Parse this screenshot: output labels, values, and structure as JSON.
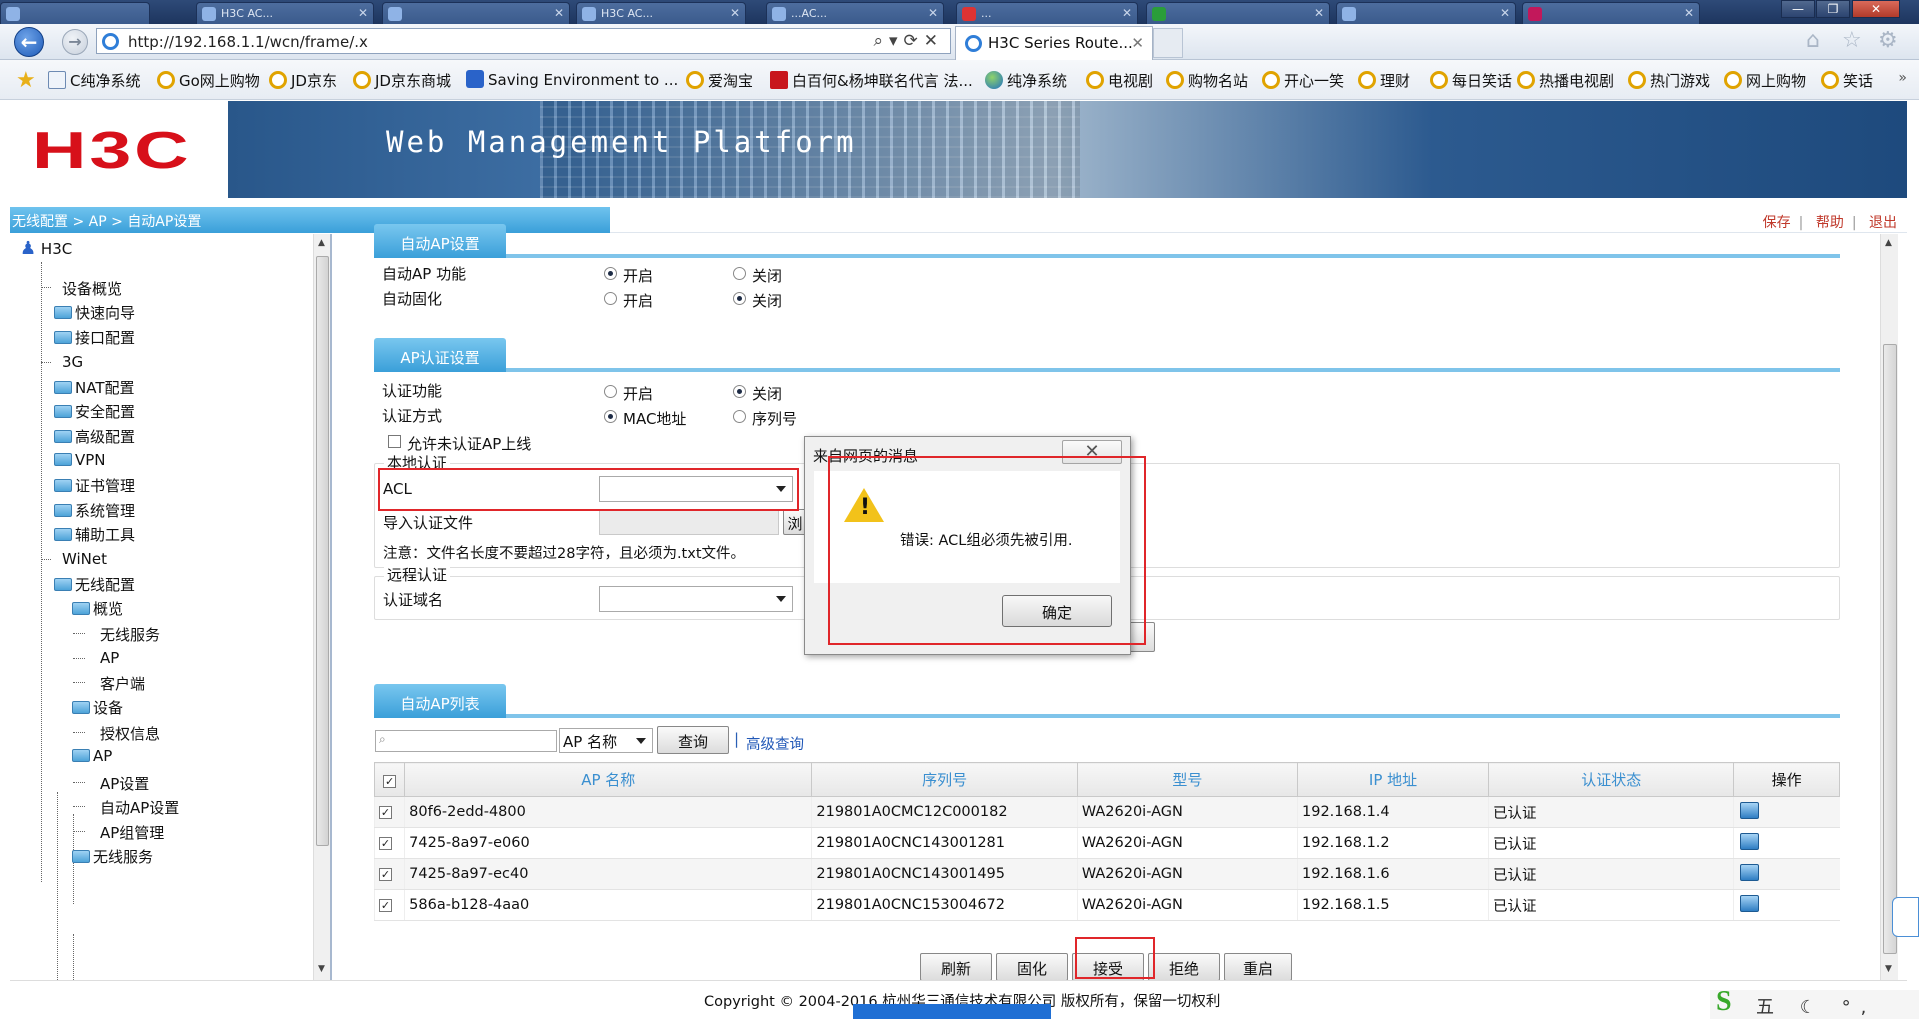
{
  "browser": {
    "tabs": [
      "",
      "H3C AC...",
      "",
      "H3C AC...",
      "...AC...",
      "...",
      "",
      "",
      ""
    ],
    "address": "http://192.168.1.1/wcn/frame/.x",
    "active_tab_title": "H3C Series Route...",
    "window_controls": {
      "minimize": "—",
      "restore": "❐",
      "close": "✕"
    }
  },
  "favorites": [
    "C纯净系统",
    "Go网上购物",
    "JD京东",
    "JD京东商城",
    "Saving Environment to ...",
    "爱淘宝",
    "白百何&杨坤联名代言 法...",
    "纯净系统",
    "电视剧",
    "购物名站",
    "开心一笑",
    "理财",
    "每日笑话",
    "热播电视剧",
    "热门游戏",
    "网上购物",
    "笑话"
  ],
  "header": {
    "logo": "H3C",
    "platform": "Web Management Platform"
  },
  "breadcrumb": [
    "无线配置",
    "AP",
    "自动AP设置"
  ],
  "top_links": [
    "保存",
    "帮助",
    "退出"
  ],
  "sidebar": {
    "root": "H3C",
    "items": [
      "设备概览",
      "快速向导",
      "接口配置",
      "3G",
      "NAT配置",
      "安全配置",
      "高级配置",
      "VPN",
      "证书管理",
      "系统管理",
      "辅助工具",
      "WiNet",
      "无线配置"
    ],
    "wireless": {
      "overview": "概览",
      "overview_children": [
        "无线服务",
        "AP",
        "客户端"
      ],
      "device": "设备",
      "device_children": [
        "授权信息"
      ],
      "ap": "AP",
      "ap_children": [
        "AP设置",
        "自动AP设置",
        "AP组管理"
      ],
      "wireless_service": "无线服务"
    }
  },
  "auto_ap": {
    "section_title": "自动AP设置",
    "auto_ap_label": "自动AP 功能",
    "auto_ap_on": "开启",
    "auto_ap_off": "关闭",
    "auto_ap_value": "开启",
    "fix_label": "自动固化",
    "fix_on": "开启",
    "fix_off": "关闭",
    "fix_value": "关闭"
  },
  "auth": {
    "section_title": "AP认证设置",
    "func_label": "认证功能",
    "func_on": "开启",
    "func_off": "关闭",
    "func_value": "关闭",
    "mode_label": "认证方式",
    "mode_mac": "MAC地址",
    "mode_serial": "序列号",
    "mode_value": "MAC地址",
    "allow_unauth": "允许未认证AP上线",
    "local_legend": "本地认证",
    "acl_label": "ACL",
    "acl_value": "",
    "import_label": "导入认证文件",
    "browse": "浏",
    "note": "注意：文件名长度不要超过28字符，且必须为.txt文件。",
    "remote_legend": "远程认证",
    "domain_label": "认证域名",
    "domain_value": ""
  },
  "list": {
    "section_title": "自动AP列表",
    "search_placeholder": "",
    "search_field": "AP 名称",
    "query_btn": "查询",
    "advanced": "高级查询",
    "columns": [
      "AP 名称",
      "序列号",
      "型号",
      "IP 地址",
      "认证状态",
      "操作"
    ],
    "rows": [
      {
        "name": "80f6-2edd-4800",
        "serial": "219801A0CMC12C000182",
        "model": "WA2620i-AGN",
        "ip": "192.168.1.4",
        "status": "已认证"
      },
      {
        "name": "7425-8a97-e060",
        "serial": "219801A0CNC143001281",
        "model": "WA2620i-AGN",
        "ip": "192.168.1.2",
        "status": "已认证"
      },
      {
        "name": "7425-8a97-ec40",
        "serial": "219801A0CNC143001495",
        "model": "WA2620i-AGN",
        "ip": "192.168.1.6",
        "status": "已认证"
      },
      {
        "name": "586a-b128-4aa0",
        "serial": "219801A0CNC153004672",
        "model": "WA2620i-AGN",
        "ip": "192.168.1.5",
        "status": "已认证"
      }
    ],
    "actions": [
      "刷新",
      "固化",
      "接受",
      "拒绝",
      "重启"
    ]
  },
  "dialog": {
    "title": "来自网页的消息",
    "close": "✕",
    "message": "错误: ACL组必须先被引用.",
    "ok": "确定"
  },
  "footer": {
    "copyright": "Copyright © 2004-2016 杭州华三通信技术有限公司 版权所有，保留一切权利"
  },
  "ime": {
    "text": "五 ☾ °, ⌨ ♟ ✎"
  },
  "colors": {
    "accent": "#3a9fd9",
    "brand_red": "#d7101a",
    "highlight_red": "#e0262a"
  }
}
